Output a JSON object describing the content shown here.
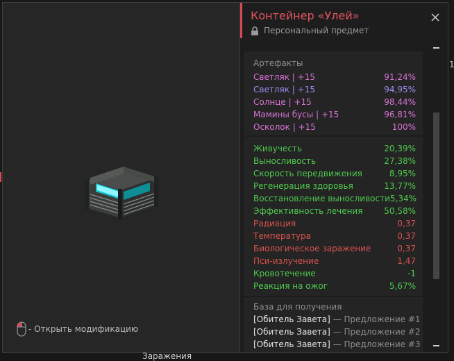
{
  "background": {
    "label": "Заражения",
    "number": "1"
  },
  "popup": {
    "title": "Контейнер «Улей»",
    "subtitle": "Персональный предмет",
    "close_icon": "close-icon",
    "lock_icon": "lock-icon",
    "artifacts_label": "Артефакты",
    "artifacts": [
      {
        "name": "Светляк | +15",
        "value": "91,24%",
        "color": "#d772d4"
      },
      {
        "name": "Светляк | +15",
        "value": "94,95%",
        "color": "#9a8ef0"
      },
      {
        "name": "Солнце | +15",
        "value": "98,44%",
        "color": "#d772d4"
      },
      {
        "name": "Мамины бусы | +15",
        "value": "96,81%",
        "color": "#d772d4"
      },
      {
        "name": "Осколок | +15",
        "value": "100%",
        "color": "#d772d4"
      }
    ],
    "stats": [
      {
        "name": "Живучесть",
        "value": "20,39%",
        "color": "#4fc94f"
      },
      {
        "name": "Выносливость",
        "value": "27,38%",
        "color": "#4fc94f"
      },
      {
        "name": "Скорость передвижения",
        "value": "8,95%",
        "color": "#4fc94f"
      },
      {
        "name": "Регенерация здоровья",
        "value": "13,77%",
        "color": "#4fc94f"
      },
      {
        "name": "Восстановление выносливости",
        "value": "5,34%",
        "color": "#4fc94f"
      },
      {
        "name": "Эффективность лечения",
        "value": "50,58%",
        "color": "#4fc94f"
      },
      {
        "name": "Радиация",
        "value": "0,37",
        "color": "#d9534f"
      },
      {
        "name": "Температура",
        "value": "0,37",
        "color": "#d9534f"
      },
      {
        "name": "Биологическое заражение",
        "value": "0,37",
        "color": "#d9534f"
      },
      {
        "name": "Пси-излучение",
        "value": "1,47",
        "color": "#d9534f"
      },
      {
        "name": "Кровотечение",
        "value": "-1",
        "color": "#4fc94f"
      },
      {
        "name": "Реакция на ожог",
        "value": "5,67%",
        "color": "#4fc94f"
      }
    ],
    "base_label": "База для получения",
    "base_items": [
      {
        "source": "[Обитель Завета]",
        "sep": "—",
        "offer": "Предложение #1"
      },
      {
        "source": "[Обитель Завета]",
        "sep": "—",
        "offer": "Предложение #2"
      },
      {
        "source": "[Обитель Завета]",
        "sep": "—",
        "offer": "Предложение #3"
      }
    ]
  },
  "preview": {
    "hint_text": "- Открыть модификацию",
    "hint_icon": "mouse-left-click-icon",
    "item_icon": "hive-container-icon"
  },
  "colors": {
    "accent": "#d84a57",
    "positive": "#4fc94f",
    "negative": "#d9534f",
    "artifact_pink": "#d772d4",
    "artifact_purple": "#9a8ef0"
  }
}
